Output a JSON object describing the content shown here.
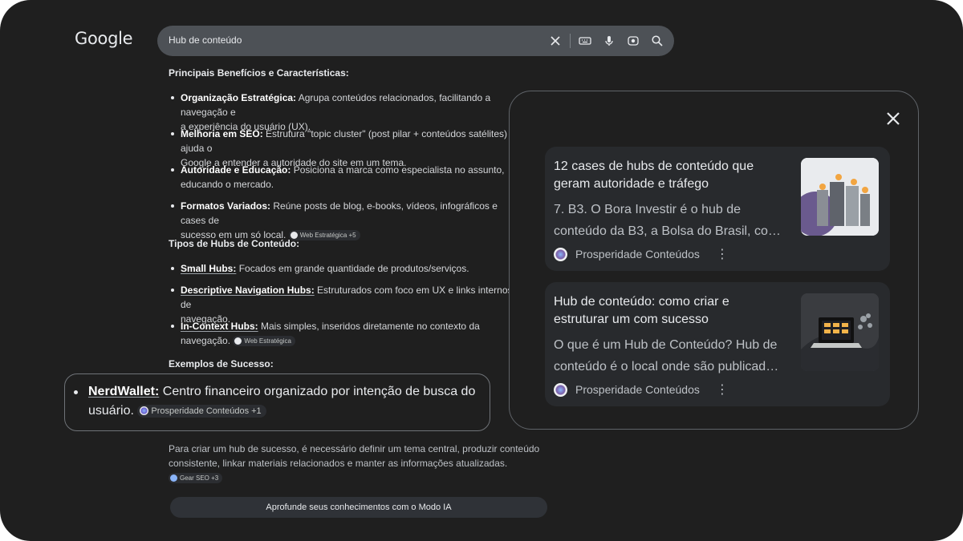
{
  "header": {
    "logo": "Google",
    "search": {
      "value": "Hub de conteúdo",
      "icons": [
        "close-icon",
        "keyboard-icon",
        "mic-icon",
        "lens-icon",
        "search-icon"
      ]
    }
  },
  "answer": {
    "heading_benefits": "Principais Benefícios e Características:",
    "benefits": [
      {
        "title": "Organização Estratégica:",
        "line1": " Agrupa conteúdos relacionados, facilitando a navegação e",
        "line2": "a experiência do usuário (UX)."
      },
      {
        "title": "Melhoria em SEO:",
        "line1": " Estrutura \"topic cluster\" (post pilar + conteúdos satélites) ajuda o",
        "line2": "Google a entender a autoridade do site em um tema."
      },
      {
        "title": "Autoridade e Educação:",
        "line1": " Posiciona a marca como especialista no assunto,",
        "line2": "educando o mercado."
      },
      {
        "title": "Formatos Variados:",
        "line1": " Reúne posts de blog, e-books, vídeos, infográficos e cases de",
        "line2": "sucesso em um só local.",
        "chip": "Web Estratégica +5"
      }
    ],
    "heading_types": "Tipos de Hubs de Conteúdo:",
    "types": [
      {
        "title": "Small Hubs:",
        "line1": " Focados em grande quantidade de produtos/serviços."
      },
      {
        "title": "Descriptive Navigation Hubs:",
        "line1": " Estruturados com foco em UX e links internos de",
        "line2": "navegação."
      },
      {
        "title": "In-Context Hubs:",
        "line1": " Mais simples, inseridos diretamente no contexto da",
        "line2": "navegação.",
        "chip": "Web Estratégica"
      }
    ],
    "heading_examples": "Exemplos de Sucesso:",
    "highlight": {
      "title": "NerdWallet:",
      "text": " Centro financeiro organizado por intenção de busca do",
      "text2": "usuário.",
      "chip": "Prosperidade Conteúdos +1"
    },
    "closing": {
      "text": "Para criar um hub de sucesso, é necessário definir um tema central, produzir conteúdo consistente, linkar materiais relacionados e manter as informações atualizadas.",
      "chip": "Gear SEO +3"
    },
    "cta": "Aprofunde seus conhecimentos com o Modo IA"
  },
  "sources_panel": {
    "cards": [
      {
        "title": "12 cases de hubs de conteúdo que geram autoridade e tráfego",
        "snippet": "7. B3. O Bora Investir é o hub de conteúdo da B3, a Bolsa do Brasil, co…",
        "source": "Prosperidade Conteúdos"
      },
      {
        "title": "Hub de conteúdo: como criar e estruturar um com sucesso",
        "snippet": "O que é um Hub de Conteúdo? Hub de conteúdo é o local onde são publicad…",
        "source": "Prosperidade Conteúdos"
      }
    ]
  },
  "colors": {
    "background": "#1f1f1f",
    "search_bar": "#4d5156",
    "card": "#282a2d",
    "text": "#e8eaed"
  }
}
